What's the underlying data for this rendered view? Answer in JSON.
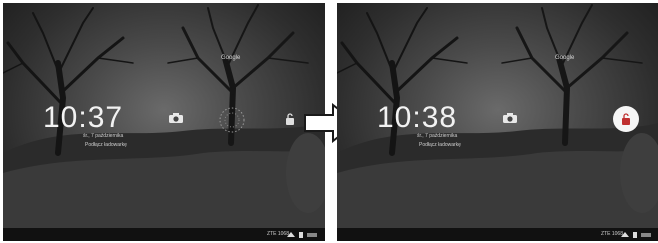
{
  "lockscreen_before": {
    "time": "10:37",
    "date": "śr.,  7 października",
    "owner": "Podłącz ładowarkę",
    "google_label": "Google",
    "status_text": "ZTE 1068"
  },
  "lockscreen_after": {
    "time": "10:38",
    "date": "śr.,  7 października",
    "owner": "Podłącz ładowarkę",
    "google_label": "Google",
    "status_text": "ZTE 1068"
  },
  "icons": {
    "camera": "camera-icon",
    "unlock": "unlock-icon",
    "arrow": "arrow-right-icon",
    "wifi": "wifi-icon",
    "battery": "battery-icon"
  },
  "colors": {
    "screen_dark": "#1c1c1c",
    "text_light": "#f2f2f2",
    "unlock_circle": "#f6f6f6"
  }
}
